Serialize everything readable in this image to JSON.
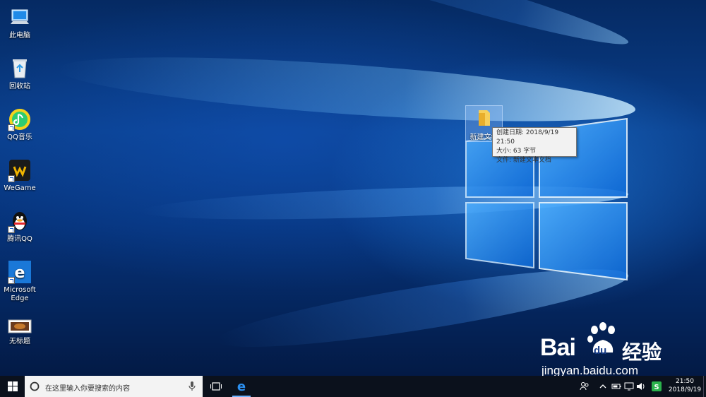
{
  "desktop_icons": [
    {
      "label": "此电脑",
      "icon": "this-pc-icon"
    },
    {
      "label": "回收站",
      "icon": "recycle-bin-icon"
    },
    {
      "label": "QQ音乐",
      "icon": "qq-music-icon"
    },
    {
      "label": "WeGame",
      "icon": "wegame-icon"
    },
    {
      "label": "腾讯QQ",
      "icon": "qq-penguin-icon"
    },
    {
      "label": "Microsoft\nEdge",
      "icon": "edge-icon"
    },
    {
      "label": "无标题",
      "icon": "image-file-icon"
    }
  ],
  "selected_file": {
    "label": "新建文件",
    "tooltip": {
      "created": "创建日期: 2018/9/19 21:50",
      "size": "大小: 63 字节",
      "type": "文件: 新建文本文档"
    }
  },
  "taskbar": {
    "search_placeholder": "在这里输入你要搜索的内容",
    "clock_time": "21:50",
    "clock_date": "2018/9/19"
  },
  "watermark": {
    "brand": "Bai",
    "brand_suffix": "du",
    "cn": "经验",
    "url": "jingyan.baidu.com"
  },
  "colors": {
    "taskbar": "#0b111c",
    "accent": "#1a78d8"
  }
}
